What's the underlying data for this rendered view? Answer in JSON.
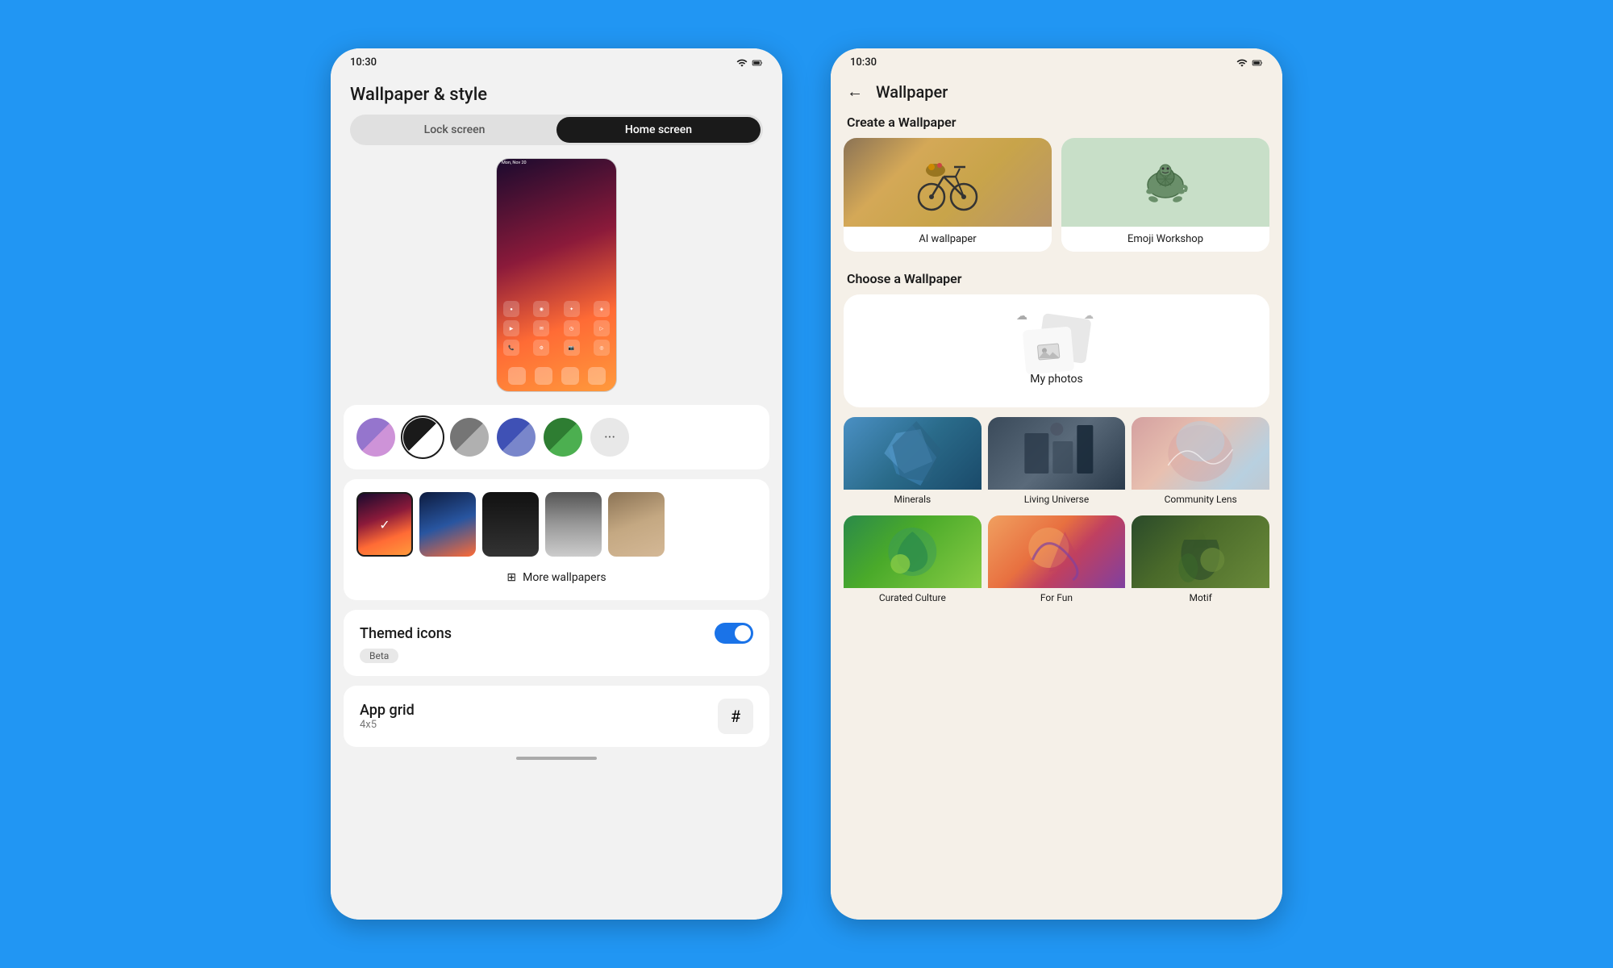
{
  "left_phone": {
    "status_bar": {
      "time": "10:30",
      "signal_icon": "signal",
      "wifi_icon": "wifi",
      "battery_icon": "battery"
    },
    "title": "Wallpaper & style",
    "tabs": [
      {
        "label": "Lock screen",
        "active": false
      },
      {
        "label": "Home screen",
        "active": true
      }
    ],
    "color_swatches": [
      {
        "color": "#9575CD",
        "secondary": "#CE93D8",
        "selected": false
      },
      {
        "color": "#1a1a1a",
        "secondary": "#fff",
        "selected": true
      },
      {
        "color": "#757575",
        "secondary": "#b0b0b0",
        "selected": false
      },
      {
        "color": "#3F51B5",
        "secondary": "#7986CB",
        "selected": false
      },
      {
        "color": "#2E7D32",
        "secondary": "#4CAF50",
        "selected": false
      }
    ],
    "more_colors_label": "···",
    "more_wallpapers_label": "More wallpapers",
    "themed_icons": {
      "title": "Themed icons",
      "beta_label": "Beta",
      "enabled": true
    },
    "app_grid": {
      "title": "App grid",
      "subtitle": "4x5",
      "icon": "#"
    }
  },
  "right_phone": {
    "status_bar": {
      "time": "10:30"
    },
    "back_label": "←",
    "title": "Wallpaper",
    "create_section_heading": "Create a Wallpaper",
    "create_options": [
      {
        "label": "AI wallpaper",
        "type": "ai"
      },
      {
        "label": "Emoji Workshop",
        "type": "emoji"
      }
    ],
    "choose_section_heading": "Choose a Wallpaper",
    "my_photos_label": "My photos",
    "wallpaper_categories": [
      {
        "label": "Minerals",
        "type": "minerals"
      },
      {
        "label": "Living Universe",
        "type": "living-universe"
      },
      {
        "label": "Community Lens",
        "type": "community-lens"
      },
      {
        "label": "Curated Culture",
        "type": "curated-culture"
      },
      {
        "label": "For Fun",
        "type": "for-fun"
      },
      {
        "label": "Motif",
        "type": "motif"
      }
    ]
  }
}
